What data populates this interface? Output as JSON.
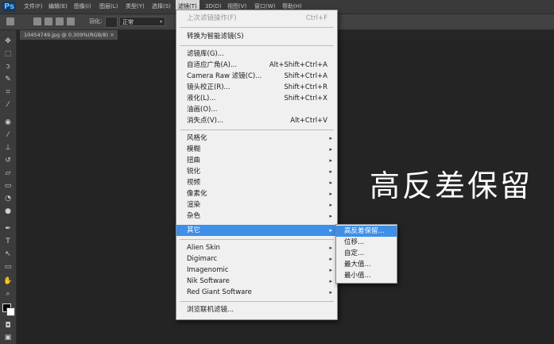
{
  "app": {
    "logo": "Ps"
  },
  "menubar": {
    "items": [
      {
        "label": "文件(F)"
      },
      {
        "label": "编辑(E)"
      },
      {
        "label": "图像(I)"
      },
      {
        "label": "图层(L)"
      },
      {
        "label": "类型(Y)"
      },
      {
        "label": "选择(S)"
      },
      {
        "label": "滤镜(T)"
      },
      {
        "label": "3D(D)"
      },
      {
        "label": "视图(V)"
      },
      {
        "label": "窗口(W)"
      },
      {
        "label": "帮助(H)"
      }
    ]
  },
  "options": {
    "feather_label": "羽化:",
    "style_value": "正常"
  },
  "document": {
    "tab_title": "10454749.jpg @ 0.309%(RGB/8)",
    "close_glyph": "×"
  },
  "filter_menu": {
    "items": [
      {
        "label": "上次滤镜操作(F)",
        "shortcut": "Ctrl+F"
      },
      {
        "label": "转换为智能滤镜(S)",
        "shortcut": ""
      },
      {
        "label": "滤镜库(G)...",
        "shortcut": ""
      },
      {
        "label": "自适应广角(A)...",
        "shortcut": "Alt+Shift+Ctrl+A"
      },
      {
        "label": "Camera Raw 滤镜(C)...",
        "shortcut": "Shift+Ctrl+A"
      },
      {
        "label": "镜头校正(R)...",
        "shortcut": "Shift+Ctrl+R"
      },
      {
        "label": "液化(L)...",
        "shortcut": "Shift+Ctrl+X"
      },
      {
        "label": "油画(O)...",
        "shortcut": ""
      },
      {
        "label": "消失点(V)...",
        "shortcut": "Alt+Ctrl+V"
      },
      {
        "label": "风格化"
      },
      {
        "label": "模糊"
      },
      {
        "label": "扭曲"
      },
      {
        "label": "锐化"
      },
      {
        "label": "视频"
      },
      {
        "label": "像素化"
      },
      {
        "label": "渲染"
      },
      {
        "label": "杂色"
      },
      {
        "label": "其它"
      },
      {
        "label": "Alien Skin"
      },
      {
        "label": "Digimarc"
      },
      {
        "label": "Imagenomic"
      },
      {
        "label": "Nik Software"
      },
      {
        "label": "Red Giant Software"
      },
      {
        "label": "浏览联机滤镜..."
      }
    ]
  },
  "other_submenu": {
    "items": [
      {
        "label": "高反差保留..."
      },
      {
        "label": "位移..."
      },
      {
        "label": "自定..."
      },
      {
        "label": "最大值..."
      },
      {
        "label": "最小值..."
      }
    ]
  },
  "annotation": {
    "text": "高反差保留"
  },
  "icons": {
    "arrow": "▸"
  }
}
